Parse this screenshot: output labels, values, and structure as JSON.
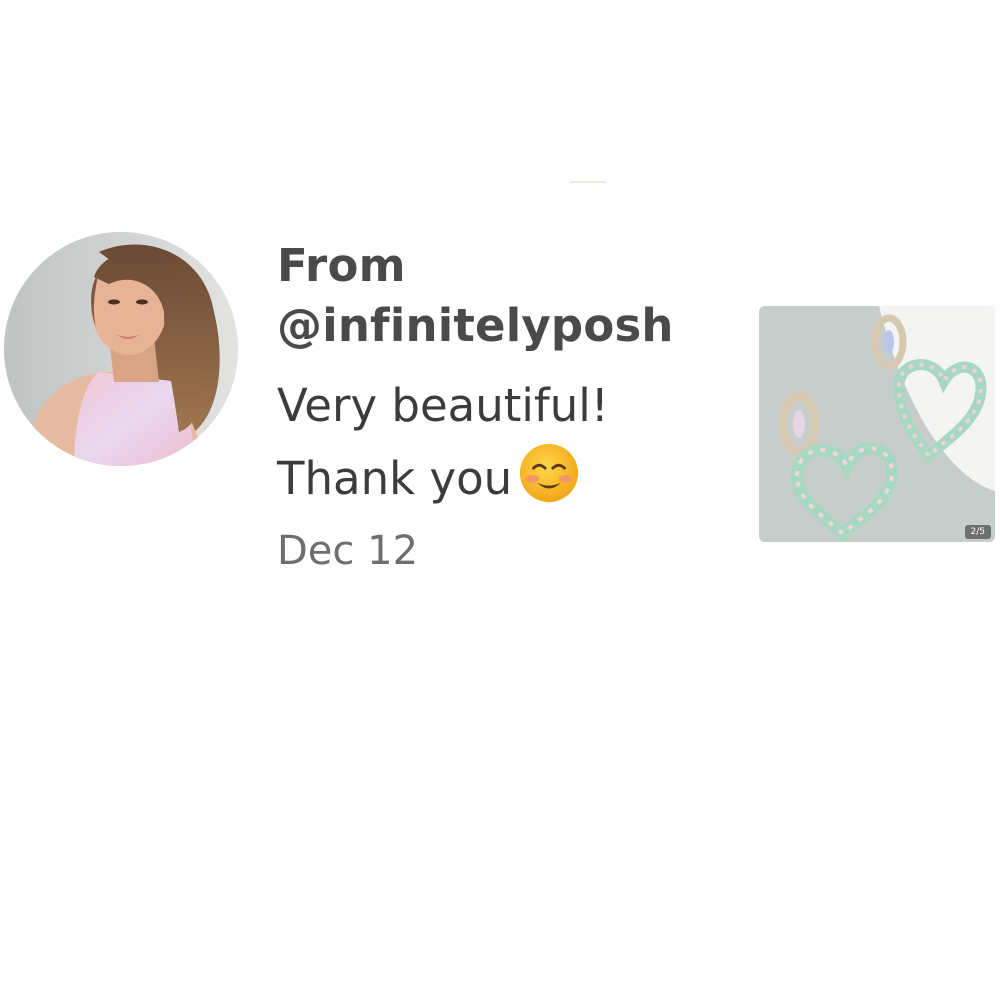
{
  "review": {
    "from_label": "From",
    "username": "@infinitelyposh",
    "message_line1": "Very beautiful!",
    "message_line2": "Thank you",
    "emoji": "smiling-face-with-smiling-eyes-icon",
    "date": "Dec 12"
  },
  "avatar": {
    "icon": "user-photo"
  },
  "product_thumbnail": {
    "image": "heart-earrings-photo",
    "counter": "2/5"
  },
  "colors": {
    "text_primary": "#3c3c3c",
    "text_secondary": "#6e6e6e",
    "background": "#ffffff"
  }
}
